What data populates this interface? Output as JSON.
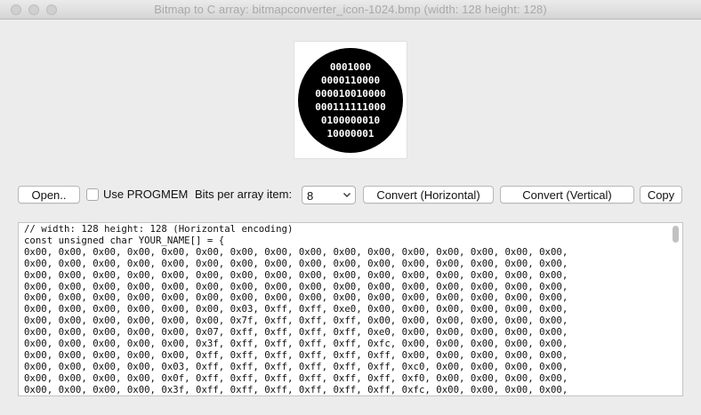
{
  "window": {
    "title": "Bitmap to C array: bitmapconverter_icon-1024.bmp (width: 128 height: 128)"
  },
  "preview": {
    "icon_lines": [
      "0001000",
      "0000110000",
      "000010010000",
      "000111111000",
      "0100000010",
      "10000001"
    ]
  },
  "toolbar": {
    "open_label": "Open..",
    "progmem_label": "Use PROGMEM",
    "progmem_checked": false,
    "bits_label": "Bits per array item:",
    "bits_value": "8",
    "convert_h_label": "Convert (Horizontal)",
    "convert_v_label": "Convert (Vertical)",
    "copy_label": "Copy"
  },
  "output": {
    "lines": [
      "// width: 128 height: 128 (Horizontal encoding)",
      "const unsigned char YOUR_NAME[] = {",
      "0x00, 0x00, 0x00, 0x00, 0x00, 0x00, 0x00, 0x00, 0x00, 0x00, 0x00, 0x00, 0x00, 0x00, 0x00, 0x00,",
      "0x00, 0x00, 0x00, 0x00, 0x00, 0x00, 0x00, 0x00, 0x00, 0x00, 0x00, 0x00, 0x00, 0x00, 0x00, 0x00,",
      "0x00, 0x00, 0x00, 0x00, 0x00, 0x00, 0x00, 0x00, 0x00, 0x00, 0x00, 0x00, 0x00, 0x00, 0x00, 0x00,",
      "0x00, 0x00, 0x00, 0x00, 0x00, 0x00, 0x00, 0x00, 0x00, 0x00, 0x00, 0x00, 0x00, 0x00, 0x00, 0x00,",
      "0x00, 0x00, 0x00, 0x00, 0x00, 0x00, 0x00, 0x00, 0x00, 0x00, 0x00, 0x00, 0x00, 0x00, 0x00, 0x00,",
      "0x00, 0x00, 0x00, 0x00, 0x00, 0x00, 0x03, 0xff, 0xff, 0xe0, 0x00, 0x00, 0x00, 0x00, 0x00, 0x00,",
      "0x00, 0x00, 0x00, 0x00, 0x00, 0x00, 0x7f, 0xff, 0xff, 0xff, 0x00, 0x00, 0x00, 0x00, 0x00, 0x00,",
      "0x00, 0x00, 0x00, 0x00, 0x00, 0x07, 0xff, 0xff, 0xff, 0xff, 0xe0, 0x00, 0x00, 0x00, 0x00, 0x00,",
      "0x00, 0x00, 0x00, 0x00, 0x00, 0x3f, 0xff, 0xff, 0xff, 0xff, 0xfc, 0x00, 0x00, 0x00, 0x00, 0x00,",
      "0x00, 0x00, 0x00, 0x00, 0x00, 0xff, 0xff, 0xff, 0xff, 0xff, 0xff, 0x00, 0x00, 0x00, 0x00, 0x00,",
      "0x00, 0x00, 0x00, 0x00, 0x03, 0xff, 0xff, 0xff, 0xff, 0xff, 0xff, 0xc0, 0x00, 0x00, 0x00, 0x00,",
      "0x00, 0x00, 0x00, 0x00, 0x0f, 0xff, 0xff, 0xff, 0xff, 0xff, 0xff, 0xf0, 0x00, 0x00, 0x00, 0x00,",
      "0x00, 0x00, 0x00, 0x00, 0x3f, 0xff, 0xff, 0xff, 0xff, 0xff, 0xff, 0xfc, 0x00, 0x00, 0x00, 0x00,"
    ]
  }
}
